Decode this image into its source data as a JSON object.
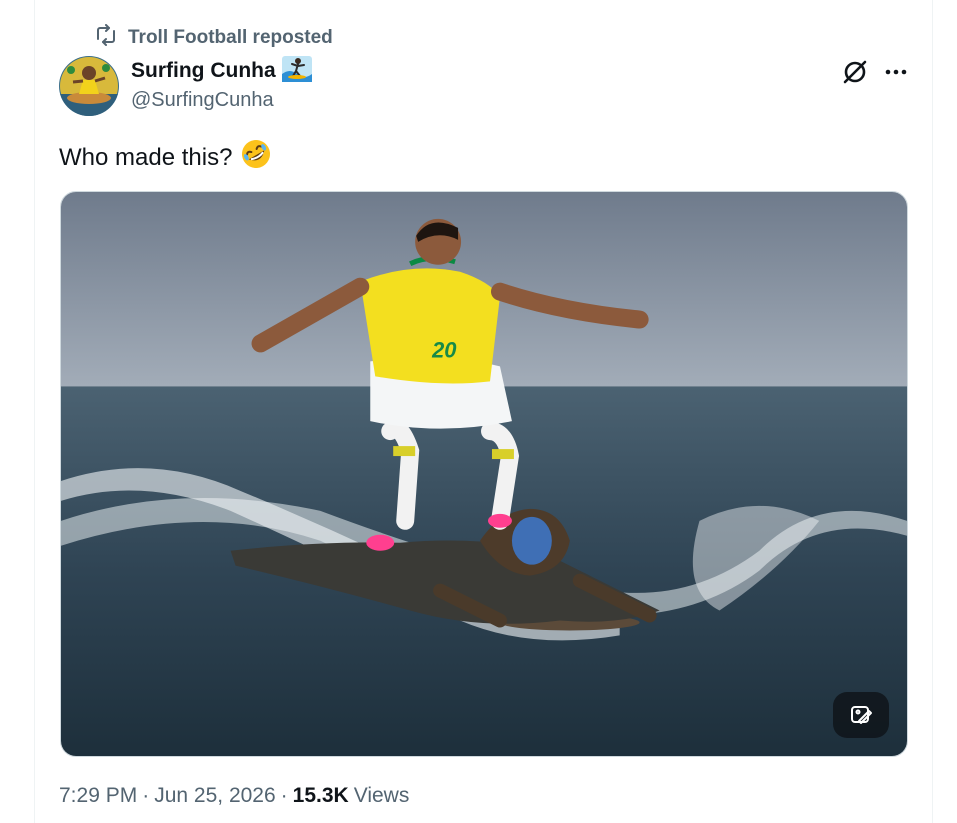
{
  "repost": {
    "text": "Troll Football reposted",
    "icon": "repost-icon"
  },
  "author": {
    "display_name": "Surfing Cunha",
    "name_emoji": "🏄",
    "handle": "@SurfingCunha"
  },
  "actions": {
    "grok_icon": "grok-icon",
    "more_icon": "more-icon"
  },
  "tweet": {
    "text": "Who made this?",
    "emoji": "🤣"
  },
  "media": {
    "jersey_number": "20",
    "edit_icon": "edit-image-icon"
  },
  "meta": {
    "time": "7:29 PM",
    "sep1": "·",
    "date": "Jun 25, 2026",
    "sep2": "·",
    "views_count": "15.3K",
    "views_label": "Views"
  },
  "colors": {
    "text_primary": "#0f1419",
    "text_secondary": "#536471",
    "border": "#cfd9de",
    "sky": "#7a8595",
    "sea": "#2f4454"
  }
}
